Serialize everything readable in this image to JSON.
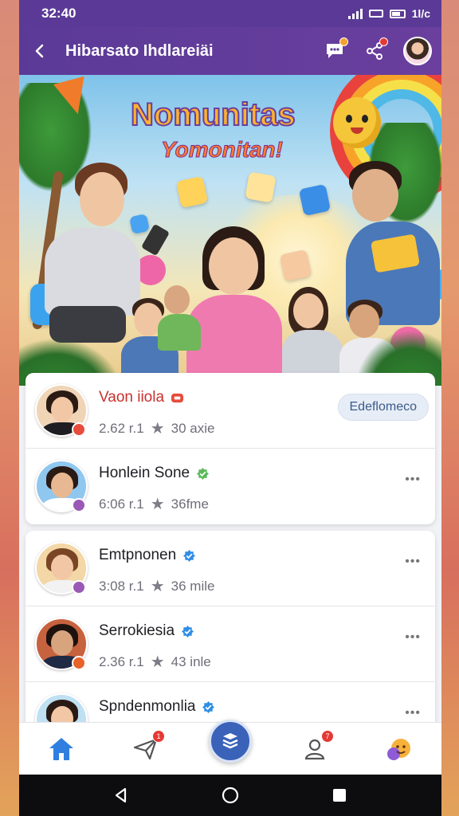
{
  "status_bar": {
    "time": "32:40",
    "right_text": "1l/c"
  },
  "app_bar": {
    "title": "Hibarsato Ihdlareiäi"
  },
  "hero": {
    "title": "Nomunitas",
    "subtitle": "Yomonitan!"
  },
  "people": [
    {
      "name": "Vaon iiola",
      "meta_left": "2.62 r.1",
      "meta_right": "30 axie",
      "action": "Edeflomeco",
      "name_color": "#c9302c",
      "badge": "red-square"
    },
    {
      "name": "Honlein Sone",
      "meta_left": "6:06 r.1",
      "meta_right": "36fme",
      "badge": "green-check"
    },
    {
      "name": "Emtpnonen",
      "meta_left": "3:08 r.1",
      "meta_right": "36 mile",
      "badge": "blue-check"
    },
    {
      "name": "Serrokiesia",
      "meta_left": "2.36 r.1",
      "meta_right": "43 inle",
      "badge": "blue-check"
    },
    {
      "name": "Spndenmonlia",
      "badge": "blue-check"
    }
  ],
  "icons": {
    "back": "arrow-left-icon",
    "chat": "chat-icon",
    "share": "share-icon",
    "star": "star-icon",
    "more": "more-horizontal-icon"
  },
  "bottom_nav": [
    {
      "id": "home",
      "icon": "home-icon",
      "badge": ""
    },
    {
      "id": "explore",
      "icon": "plane-icon",
      "badge": "1"
    },
    {
      "id": "center",
      "icon": "stack-icon",
      "badge": ""
    },
    {
      "id": "contacts",
      "icon": "person-icon",
      "badge": "7"
    },
    {
      "id": "profile",
      "icon": "emoji-icon",
      "badge": ""
    }
  ],
  "colors": {
    "primary": "#5b3a97",
    "accent": "#3a62b8",
    "badge": "#e53935"
  }
}
